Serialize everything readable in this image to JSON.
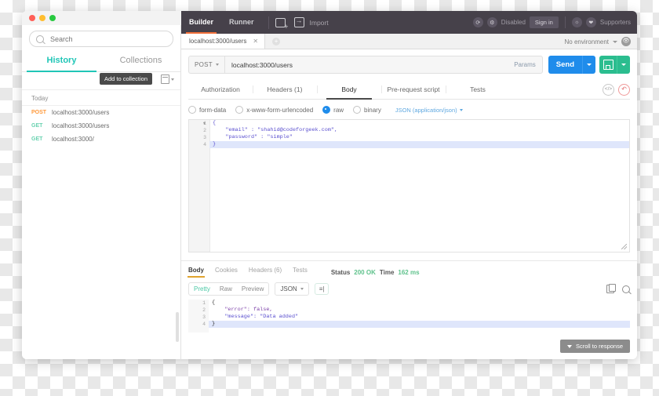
{
  "window": {
    "traffic_lights": [
      "close",
      "minimize",
      "maximize"
    ]
  },
  "sidebar": {
    "search": {
      "placeholder": "Search",
      "value": "",
      "icon": "search-icon"
    },
    "tabs": [
      {
        "label": "History",
        "active": true
      },
      {
        "label": "Collections",
        "active": false
      }
    ],
    "tooltip": "Add to collection",
    "trash_icon": "trash-icon",
    "group_header": "Today",
    "history": [
      {
        "method": "POST",
        "url": "localhost:3000/users"
      },
      {
        "method": "GET",
        "url": "localhost:3000/users"
      },
      {
        "method": "GET",
        "url": "localhost:3000/"
      }
    ]
  },
  "toolbar": {
    "modes": [
      {
        "label": "Builder",
        "active": true
      },
      {
        "label": "Runner",
        "active": false
      }
    ],
    "new_tab_icon": "new-tab-icon",
    "import_icon": "import-icon",
    "import_label": "Import",
    "sync_icon": "sync-icon",
    "settings_icon": "gear-icon",
    "disabled_label": "Disabled",
    "signin_label": "Sign in",
    "alert_icon": "bell-icon",
    "heart_icon": "heart-icon",
    "supporters_label": "Supporters"
  },
  "tabstrip": {
    "tabs": [
      {
        "label": "localhost:3000/users",
        "active": true
      }
    ],
    "close_icon": "close-icon",
    "add_tab_icon": "plus-icon",
    "environment_label": "No environment",
    "env_caret_icon": "chevron-down-icon",
    "env_eye_icon": "eye-icon"
  },
  "request": {
    "method": "POST",
    "method_caret_icon": "chevron-down-icon",
    "url": "localhost:3000/users",
    "params_label": "Params",
    "send_label": "Send",
    "send_caret_icon": "chevron-down-icon",
    "save_icon": "save-icon",
    "save_caret_icon": "chevron-down-icon",
    "tabs": [
      {
        "label": "Authorization",
        "active": false
      },
      {
        "label": "Headers (1)",
        "active": false
      },
      {
        "label": "Body",
        "active": true
      },
      {
        "label": "Pre-request script",
        "active": false
      },
      {
        "label": "Tests",
        "active": false
      }
    ],
    "code_icon": "code-icon",
    "reset_icon": "undo-icon",
    "body_types": [
      {
        "label": "form-data",
        "selected": false
      },
      {
        "label": "x-www-form-urlencoded",
        "selected": false
      },
      {
        "label": "raw",
        "selected": true
      },
      {
        "label": "binary",
        "selected": false
      }
    ],
    "content_type": "JSON (application/json)",
    "content_type_caret_icon": "chevron-down-icon",
    "editor": {
      "lines": [
        {
          "number": "1",
          "text": "{",
          "highlight": false,
          "fold": true
        },
        {
          "number": "2",
          "text": "    \"email\" : \"shahid@codeforgeek.com\",",
          "highlight": false,
          "fold": false
        },
        {
          "number": "3",
          "text": "    \"password\" : \"simple\"",
          "highlight": false,
          "fold": false
        },
        {
          "number": "4",
          "text": "}",
          "highlight": true,
          "fold": false
        }
      ],
      "resize_handle_icon": "resize-grip-icon"
    }
  },
  "response": {
    "tabs": [
      {
        "label": "Body",
        "active": true
      },
      {
        "label": "Cookies",
        "active": false
      },
      {
        "label": "Headers (6)",
        "active": false
      },
      {
        "label": "Tests",
        "active": false
      }
    ],
    "status_label": "Status",
    "status_value": "200 OK",
    "time_label": "Time",
    "time_value": "162 ms",
    "view_modes": [
      {
        "label": "Pretty",
        "active": true
      },
      {
        "label": "Raw",
        "active": false
      },
      {
        "label": "Preview",
        "active": false
      }
    ],
    "format": "JSON",
    "format_caret_icon": "chevron-down-icon",
    "wrap_icon": "word-wrap-icon",
    "copy_icon": "copy-icon",
    "search_icon": "search-icon",
    "body_lines": [
      {
        "number": "1",
        "text": "{",
        "highlight": false
      },
      {
        "number": "2",
        "text": "    \"error\": false,",
        "highlight": false
      },
      {
        "number": "3",
        "text": "    \"message\": \"Data added\"",
        "highlight": false
      },
      {
        "number": "4",
        "text": "}",
        "highlight": true
      }
    ],
    "scroll_button": "Scroll to response",
    "scroll_caret_icon": "chevron-down-icon"
  },
  "colors": {
    "teal": "#20c6b7",
    "orange": "#f2703a",
    "blue": "#1f8ceb",
    "green": "#2bbd8f",
    "status_green": "#5fc28c",
    "toolbar_dark": "#46414a",
    "amber": "#e0a32e"
  }
}
